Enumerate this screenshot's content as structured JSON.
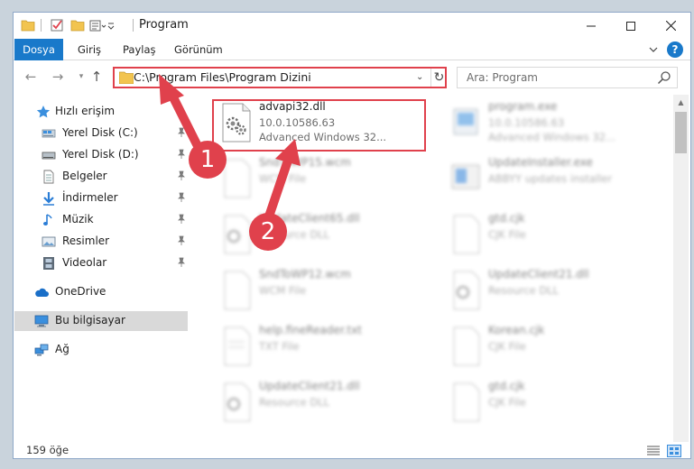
{
  "window": {
    "title": "Program",
    "controls": {
      "minimize": "–",
      "maximize": "☐",
      "close": "✕"
    }
  },
  "ribbon": {
    "tabs": [
      {
        "label": "Dosya"
      },
      {
        "label": "Giriş"
      },
      {
        "label": "Paylaş"
      },
      {
        "label": "Görünüm"
      }
    ],
    "help": "?"
  },
  "nav": {
    "back": "←",
    "forward": "→",
    "recent": "▾",
    "up": "↑",
    "address": "C:\\Program Files\\Program Dizini",
    "address_chevron": "⌄",
    "refresh": "↻",
    "search_placeholder": "Ara: Program"
  },
  "sidebar": {
    "quick_access": "Hızlı erişim",
    "items": [
      {
        "label": "Yerel Disk (C:)"
      },
      {
        "label": "Yerel Disk (D:)"
      },
      {
        "label": "Belgeler"
      },
      {
        "label": "İndirmeler"
      },
      {
        "label": "Müzik"
      },
      {
        "label": "Resimler"
      },
      {
        "label": "Videolar"
      }
    ],
    "onedrive": "OneDrive",
    "this_pc": "Bu bilgisayar",
    "network": "Ağ"
  },
  "files": [
    {
      "name": "advapi32.dll",
      "line1": "10.0.10586.63",
      "line2": "Advanced Windows 32..."
    },
    {
      "name": "program.exe",
      "line1": "10.0.10586.63",
      "line2": "Advanced Windows 32..."
    },
    {
      "name": "SndToWP15.wcm",
      "line1": "WCM File",
      "line2": ""
    },
    {
      "name": "UpdateInstaller.exe",
      "line1": "ABBYY updates installer",
      "line2": ""
    },
    {
      "name": "UpdateClient65.dll",
      "line1": "Resource DLL",
      "line2": ""
    },
    {
      "name": "gtd.cjk",
      "line1": "CJK File",
      "line2": ""
    },
    {
      "name": "SndToWP12.wcm",
      "line1": "WCM File",
      "line2": ""
    },
    {
      "name": "UpdateClient21.dll",
      "line1": "Resource DLL",
      "line2": ""
    },
    {
      "name": "help.fineReader.txt",
      "line1": "TXT File",
      "line2": ""
    },
    {
      "name": "Korean.cjk",
      "line1": "CJK File",
      "line2": ""
    },
    {
      "name": "UpdateClient21.dll",
      "line1": "Resource DLL",
      "line2": ""
    },
    {
      "name": "gtd.cjk",
      "line1": "CJK File",
      "line2": ""
    }
  ],
  "status": {
    "count": "159 öğe"
  },
  "annotations": {
    "step1": "1",
    "step2": "2"
  },
  "colors": {
    "accent": "#1979ca",
    "highlight": "#e0414c",
    "folder": "#f2c44f"
  }
}
